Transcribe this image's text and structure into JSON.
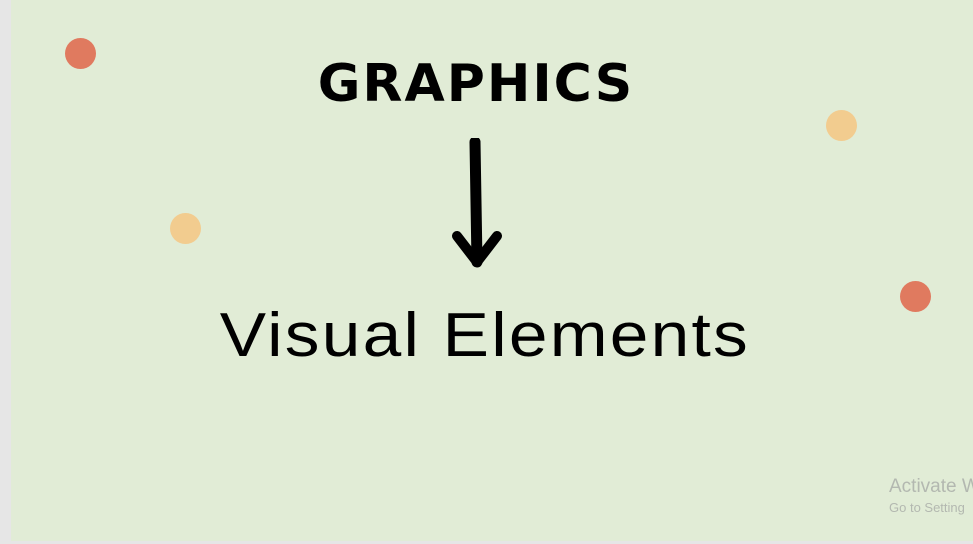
{
  "slide": {
    "title": "GRAPHICS",
    "subtitle": "Visual Elements"
  },
  "decorations": {
    "arrow_icon": "arrow-down-icon",
    "dot_colors": [
      "#e07a5f",
      "#f2cc8f",
      "#f2cc8f",
      "#e07a5f"
    ]
  },
  "watermark": {
    "line1": "Activate W",
    "line2": "Go to Setting"
  }
}
